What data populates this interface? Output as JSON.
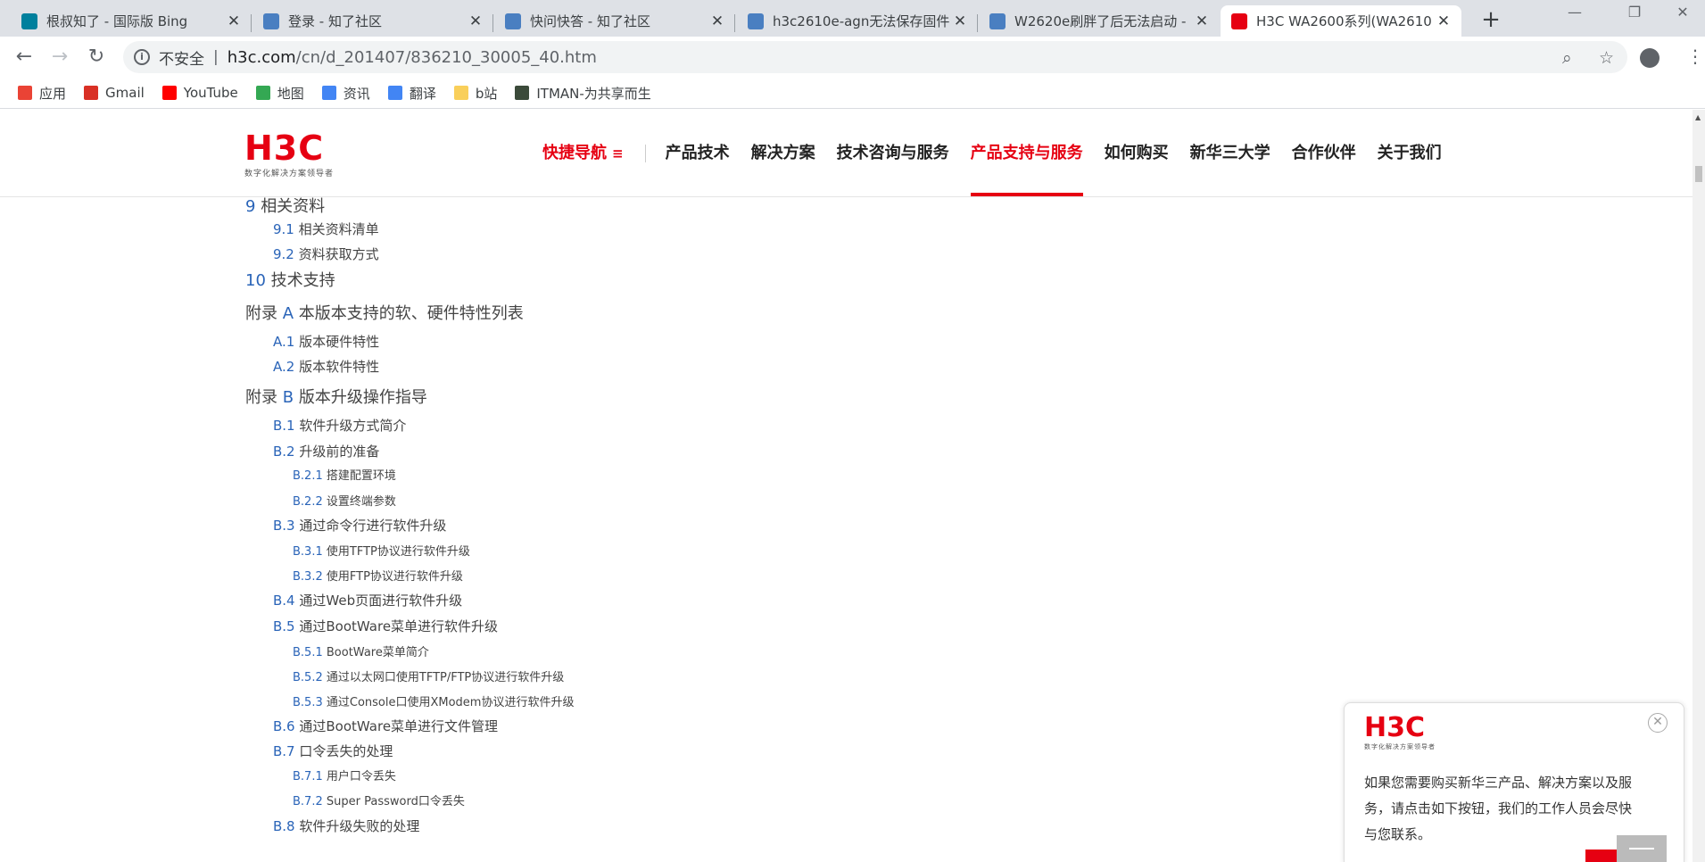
{
  "tabs": [
    {
      "title": "根叔知了 - 国际版 Bing",
      "favicon": "bing-icon",
      "color": "#00809d",
      "active": false
    },
    {
      "title": "登录 - 知了社区",
      "favicon": "zhiliao-icon",
      "color": "#4a7fc1",
      "active": false
    },
    {
      "title": "快问快答 - 知了社区",
      "favicon": "zhiliao-icon",
      "color": "#4a7fc1",
      "active": false
    },
    {
      "title": "h3c2610e-agn无法保存固件",
      "favicon": "zhiliao-icon",
      "color": "#4a7fc1",
      "active": false
    },
    {
      "title": "W2620e刷胖了后无法启动 -",
      "favicon": "zhiliao-icon",
      "color": "#4a7fc1",
      "active": false
    },
    {
      "title": "H3C WA2600系列(WA2610",
      "favicon": "h3c-icon",
      "color": "#e60012",
      "active": true
    }
  ],
  "toolbar": {
    "security_label": "不安全",
    "url_host": "h3c.com",
    "url_path": "/cn/d_201407/836210_30005_40.htm"
  },
  "bookmarks": [
    {
      "label": "应用",
      "icon": "apps-grid-icon",
      "color": "#ea4335"
    },
    {
      "label": "Gmail",
      "icon": "gmail-icon",
      "color": "#d93025"
    },
    {
      "label": "YouTube",
      "icon": "youtube-icon",
      "color": "#ff0000"
    },
    {
      "label": "地图",
      "icon": "maps-icon",
      "color": "#34a853"
    },
    {
      "label": "资讯",
      "icon": "news-icon",
      "color": "#4285f4"
    },
    {
      "label": "翻译",
      "icon": "translate-icon",
      "color": "#4285f4"
    },
    {
      "label": "b站",
      "icon": "folder-icon",
      "color": "#f9cf5a"
    },
    {
      "label": "ITMAN-为共享而生",
      "icon": "itman-icon",
      "color": "#3b4a3a"
    }
  ],
  "site": {
    "logo": "H3C",
    "slogan": "数字化解决方案领导者",
    "nav": [
      {
        "label": "快捷导航",
        "quick": true,
        "active": false
      },
      {
        "label": "产品技术",
        "quick": false,
        "active": false
      },
      {
        "label": "解决方案",
        "quick": false,
        "active": false
      },
      {
        "label": "技术咨询与服务",
        "quick": false,
        "active": false
      },
      {
        "label": "产品支持与服务",
        "quick": false,
        "active": true
      },
      {
        "label": "如何购买",
        "quick": false,
        "active": false
      },
      {
        "label": "新华三大学",
        "quick": false,
        "active": false
      },
      {
        "label": "合作伙伴",
        "quick": false,
        "active": false
      },
      {
        "label": "关于我们",
        "quick": false,
        "active": false
      }
    ]
  },
  "toc": [
    {
      "level": 1,
      "num": "9",
      "text": "相关资料"
    },
    {
      "level": 2,
      "num": "9.1",
      "text": "相关资料清单"
    },
    {
      "level": 2,
      "num": "9.2",
      "text": "资料获取方式"
    },
    {
      "level": 1,
      "num": "10",
      "text": "技术支持"
    },
    {
      "level": 1,
      "prefix": "附录 ",
      "num": "A",
      "text": "本版本支持的软、硬件特性列表"
    },
    {
      "level": 2,
      "num": "A.1",
      "text": "版本硬件特性"
    },
    {
      "level": 2,
      "num": "A.2",
      "text": "版本软件特性"
    },
    {
      "level": 1,
      "prefix": "附录 ",
      "num": "B",
      "text": "版本升级操作指导"
    },
    {
      "level": 2,
      "num": "B.1",
      "text": "软件升级方式简介"
    },
    {
      "level": 2,
      "num": "B.2",
      "text": "升级前的准备"
    },
    {
      "level": 3,
      "num": "B.2.1",
      "text": "搭建配置环境"
    },
    {
      "level": 3,
      "num": "B.2.2",
      "text": "设置终端参数"
    },
    {
      "level": 2,
      "num": "B.3",
      "text": "通过命令行进行软件升级"
    },
    {
      "level": 3,
      "num": "B.3.1",
      "text": "使用TFTP协议进行软件升级"
    },
    {
      "level": 3,
      "num": "B.3.2",
      "text": "使用FTP协议进行软件升级"
    },
    {
      "level": 2,
      "num": "B.4",
      "text": "通过Web页面进行软件升级"
    },
    {
      "level": 2,
      "num": "B.5",
      "text": "通过BootWare菜单进行软件升级"
    },
    {
      "level": 3,
      "num": "B.5.1",
      "text": "BootWare菜单简介"
    },
    {
      "level": 3,
      "num": "B.5.2",
      "text": "通过以太网口使用TFTP/FTP协议进行软件升级"
    },
    {
      "level": 3,
      "num": "B.5.3",
      "text": "通过Console口使用XModem协议进行软件升级"
    },
    {
      "level": 2,
      "num": "B.6",
      "text": "通过BootWare菜单进行文件管理"
    },
    {
      "level": 2,
      "num": "B.7",
      "text": "口令丢失的处理"
    },
    {
      "level": 3,
      "num": "B.7.1",
      "text": "用户口令丢失"
    },
    {
      "level": 3,
      "num": "B.7.2",
      "text": "Super Password口令丢失"
    },
    {
      "level": 2,
      "num": "B.8",
      "text": "软件升级失败的处理"
    }
  ],
  "popup": {
    "logo": "H3C",
    "slogan": "数字化解决方案领导者",
    "message": "如果您需要购买新华三产品、解决方案以及服务，请点击如下按钮，我们的工作人员会尽快与您联系。"
  }
}
